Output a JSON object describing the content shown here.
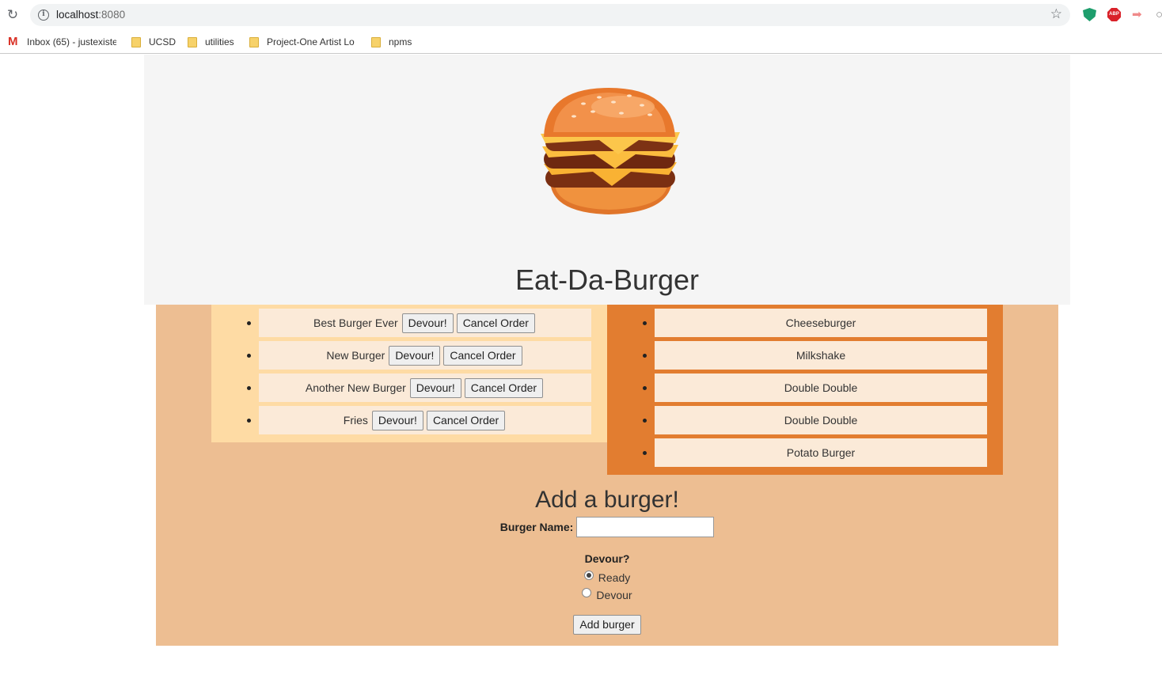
{
  "browser": {
    "url_host": "localhost",
    "url_port": ":8080",
    "bookmarks": [
      {
        "label": "Inbox (65) - justexiste",
        "icon": "gmail-icon"
      },
      {
        "label": "UCSD",
        "icon": "folder-icon"
      },
      {
        "label": "utilities",
        "icon": "folder-icon"
      },
      {
        "label": "Project-One Artist Lo",
        "icon": "folder-icon"
      },
      {
        "label": "npms",
        "icon": "folder-icon"
      }
    ],
    "extensions": [
      "shield-extension-icon",
      "adblock-plus-icon",
      "arrow-extension-icon"
    ]
  },
  "header": {
    "title": "Eat-Da-Burger",
    "logo": "burger-logo"
  },
  "ready_list": [
    {
      "name": "Best Burger Ever",
      "devour_label": "Devour!",
      "cancel_label": "Cancel Order"
    },
    {
      "name": "New Burger",
      "devour_label": "Devour!",
      "cancel_label": "Cancel Order"
    },
    {
      "name": "Another New Burger",
      "devour_label": "Devour!",
      "cancel_label": "Cancel Order"
    },
    {
      "name": "Fries",
      "devour_label": "Devour!",
      "cancel_label": "Cancel Order"
    }
  ],
  "devoured_list": [
    {
      "name": "Cheeseburger"
    },
    {
      "name": "Milkshake"
    },
    {
      "name": "Double Double"
    },
    {
      "name": "Double Double"
    },
    {
      "name": "Potato Burger"
    }
  ],
  "form": {
    "heading": "Add a burger!",
    "name_label": "Burger Name:",
    "name_value": "",
    "devour_question": "Devour?",
    "options": [
      {
        "label": "Ready",
        "checked": true
      },
      {
        "label": "Devour",
        "checked": false
      }
    ],
    "submit_label": "Add burger"
  },
  "colors": {
    "page_bg": "#edbe92",
    "ready_column": "#fedba4",
    "devoured_column": "#e27d30",
    "item_bg": "#fbead8",
    "jumbotron": "#f5f5f5"
  }
}
